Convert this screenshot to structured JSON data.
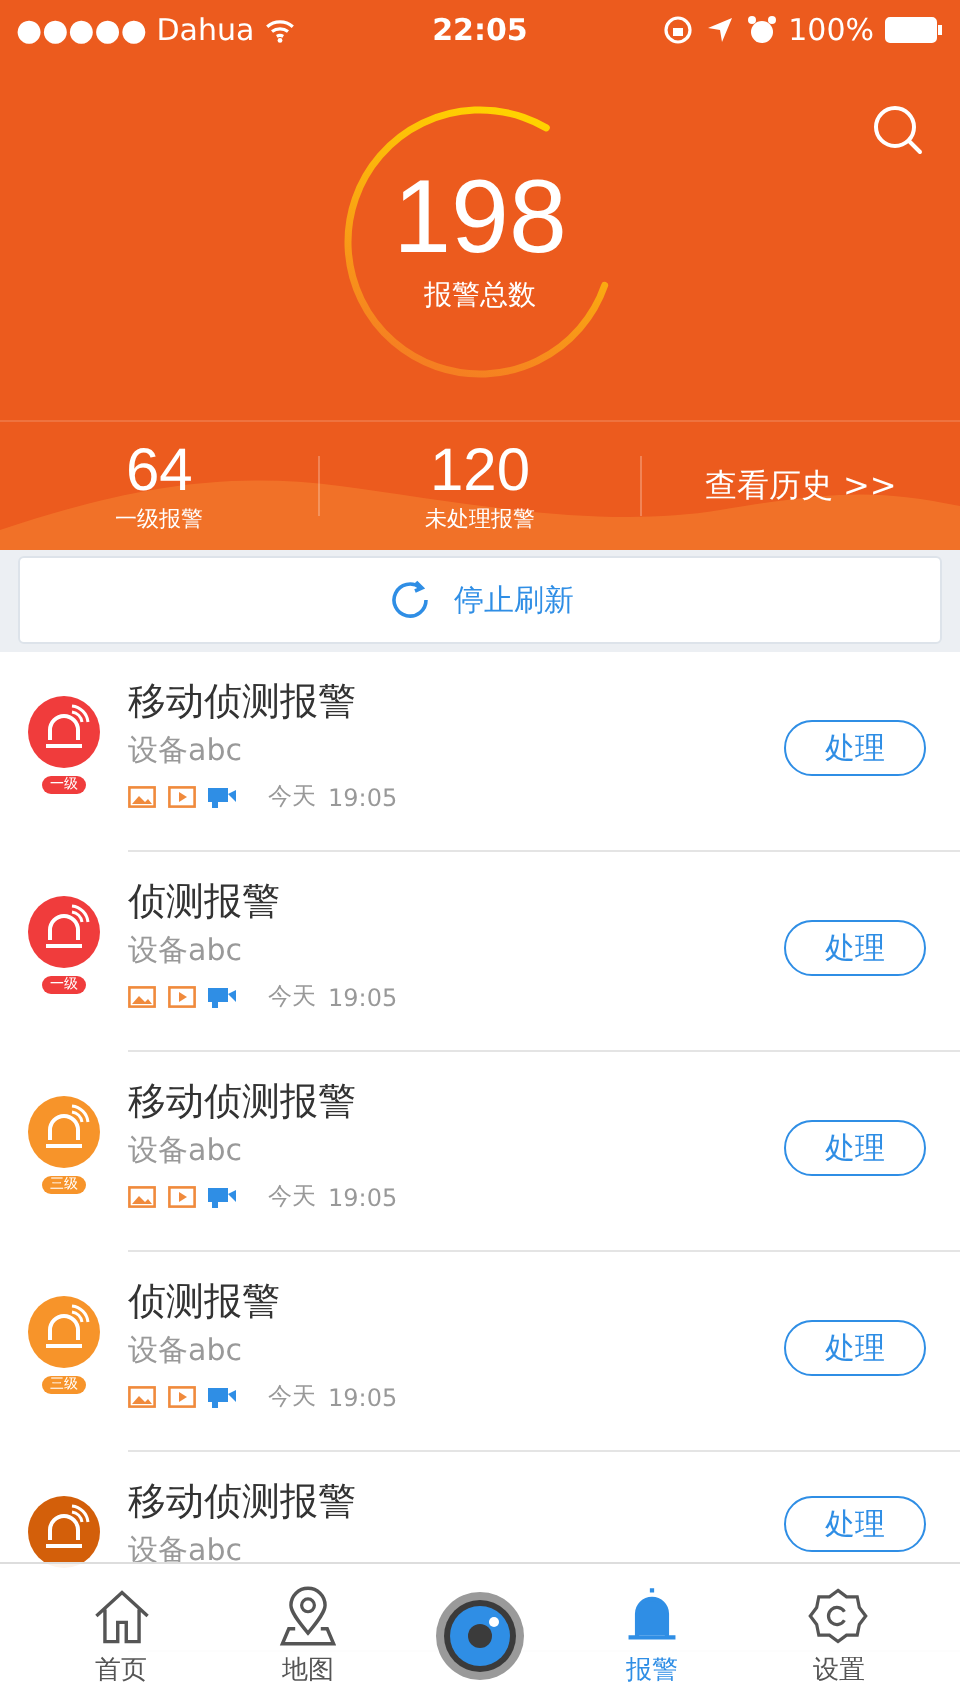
{
  "status_bar": {
    "carrier": "●●●●● Dahua",
    "time": "22:05",
    "battery": "100%"
  },
  "summary": {
    "total": "198",
    "total_label": "报警总数",
    "level": 0.78,
    "stats": [
      {
        "value": "64",
        "label": "一级报警"
      },
      {
        "value": "120",
        "label": "未处理报警"
      }
    ],
    "history_link": "查看历史 >>"
  },
  "refresh_button": "停止刷新",
  "alarms": [
    {
      "title": "移动侦测报警",
      "device": "设备abc",
      "grade": "一级",
      "color": "#f03c3c",
      "day": "今天",
      "time": "19:05",
      "action": "处理"
    },
    {
      "title": "侦测报警",
      "device": "设备abc",
      "grade": "一级",
      "color": "#f03c3c",
      "day": "今天",
      "time": "19:05",
      "action": "处理"
    },
    {
      "title": "移动侦测报警",
      "device": "设备abc",
      "grade": "三级",
      "color": "#f7942a",
      "day": "今天",
      "time": "19:05",
      "action": "处理"
    },
    {
      "title": "侦测报警",
      "device": "设备abc",
      "grade": "三级",
      "color": "#f7942a",
      "day": "今天",
      "time": "19:05",
      "action": "处理"
    },
    {
      "title": "移动侦测报警",
      "device": "设备abc",
      "color": "#d35f0a",
      "action": "处理"
    }
  ],
  "tab_bar": [
    {
      "kind": "home",
      "label": "首页",
      "selected": false
    },
    {
      "kind": "map",
      "label": "地图",
      "selected": false
    },
    {
      "kind": "camera"
    },
    {
      "kind": "alarm",
      "label": "报警",
      "selected": true
    },
    {
      "kind": "settings",
      "label": "设置",
      "selected": false
    }
  ]
}
